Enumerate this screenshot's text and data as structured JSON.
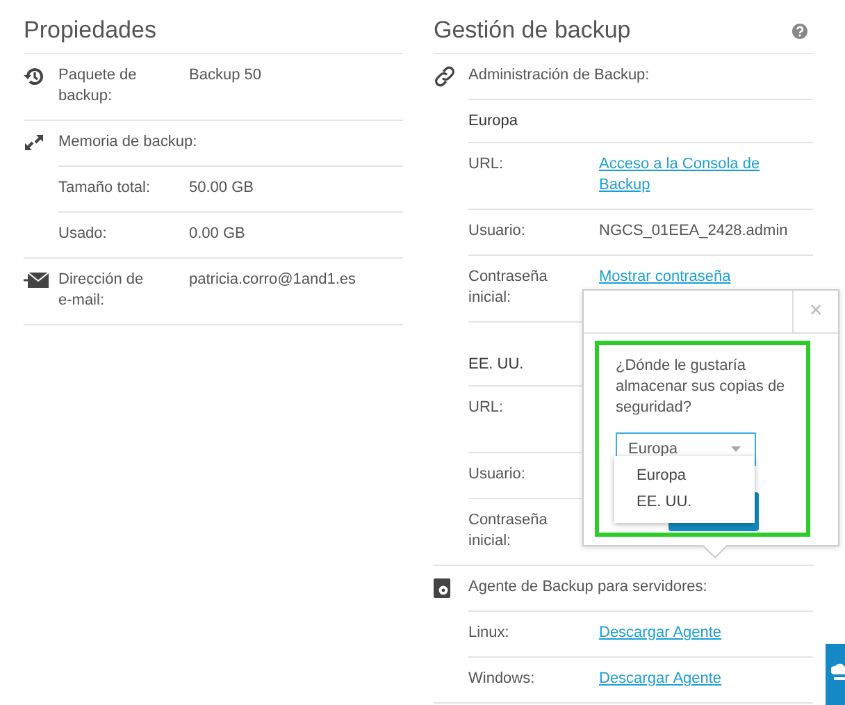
{
  "properties": {
    "title": "Propiedades",
    "rows": [
      {
        "kind": "section",
        "label": "Paquete de backup:",
        "value": "Backup 50"
      },
      {
        "kind": "section",
        "label": "Memoria de backup:"
      },
      {
        "kind": "detail",
        "label": "Tamaño total:",
        "value": "50.00 GB"
      },
      {
        "kind": "detail",
        "label": "Usado:",
        "value": "0.00 GB"
      },
      {
        "kind": "section",
        "label": "Dirección de e-mail:",
        "value": "patricia.corro@1and1.es"
      }
    ]
  },
  "backup_management": {
    "title": "Gestión de backup",
    "rows": [
      {
        "kind": "section",
        "label": "Administración de Backup:"
      },
      {
        "kind": "region",
        "label": "Europa"
      },
      {
        "kind": "detail",
        "label": "URL:",
        "link": "Acceso a la Consola de Backup"
      },
      {
        "kind": "detail",
        "label": "Usuario:",
        "value": "NGCS_01EEA_2428.admin"
      },
      {
        "kind": "detail",
        "label": "Contraseña inicial:",
        "link": "Mostrar contraseña"
      },
      {
        "kind": "region",
        "label": "EE. UU."
      },
      {
        "kind": "detail",
        "label": "URL:"
      },
      {
        "kind": "detail",
        "label": "Usuario:"
      },
      {
        "kind": "detail",
        "label": "Contraseña inicial:"
      },
      {
        "kind": "section",
        "label": "Agente de Backup para servidores:"
      },
      {
        "kind": "detail",
        "label": "Linux:",
        "link": "Descargar Agente"
      },
      {
        "kind": "detail",
        "label": "Windows:",
        "link": "Descargar Agente"
      }
    ]
  },
  "popover": {
    "close": "×",
    "question": "¿Dónde le gustaría almacenar sus copias de seguridad?",
    "select": {
      "value": "Europa"
    },
    "options": [
      "Europa",
      "EE. UU."
    ]
  }
}
